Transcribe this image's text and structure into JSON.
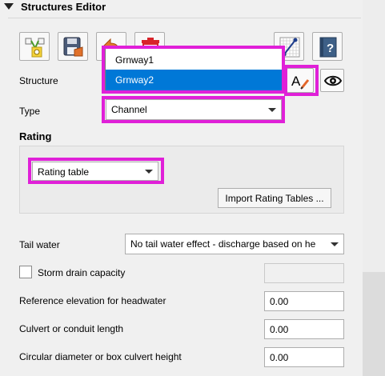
{
  "panel": {
    "title": "Structures Editor"
  },
  "toolbar": {
    "buttons": [
      {
        "name": "add-structure-button",
        "icon": "add-node-icon"
      },
      {
        "name": "save-button",
        "icon": "save-icon"
      },
      {
        "name": "revert-button",
        "icon": "undo-arrow-icon"
      },
      {
        "name": "delete-button",
        "icon": "delete-icon"
      },
      {
        "name": "schematize-button",
        "icon": "schematize-icon"
      },
      {
        "name": "help-button",
        "icon": "help-book-icon"
      }
    ]
  },
  "structure": {
    "label": "Structure",
    "options": [
      "Grnway1",
      "Grnway2"
    ],
    "selected": "Grnway2",
    "rename_icon": "rename-icon",
    "view_icon": "eye-icon"
  },
  "type": {
    "label": "Type",
    "value": "Channel"
  },
  "rating": {
    "label": "Rating",
    "value": "Rating table",
    "import_button": "Import Rating Tables ..."
  },
  "tail_water": {
    "label": "Tail water",
    "value": "No tail water effect - discharge based on he"
  },
  "storm_drain": {
    "label": "Storm drain capacity",
    "checked": false,
    "value": ""
  },
  "fields": {
    "ref_elevation": {
      "label": "Reference elevation for headwater",
      "value": "0.00"
    },
    "culvert_length": {
      "label": "Culvert or conduit length",
      "value": "0.00"
    },
    "diameter": {
      "label": "Circular diameter or box culvert height",
      "value": "0.00"
    }
  },
  "colors": {
    "highlight": "#e020d8",
    "selection": "#0078d7"
  }
}
